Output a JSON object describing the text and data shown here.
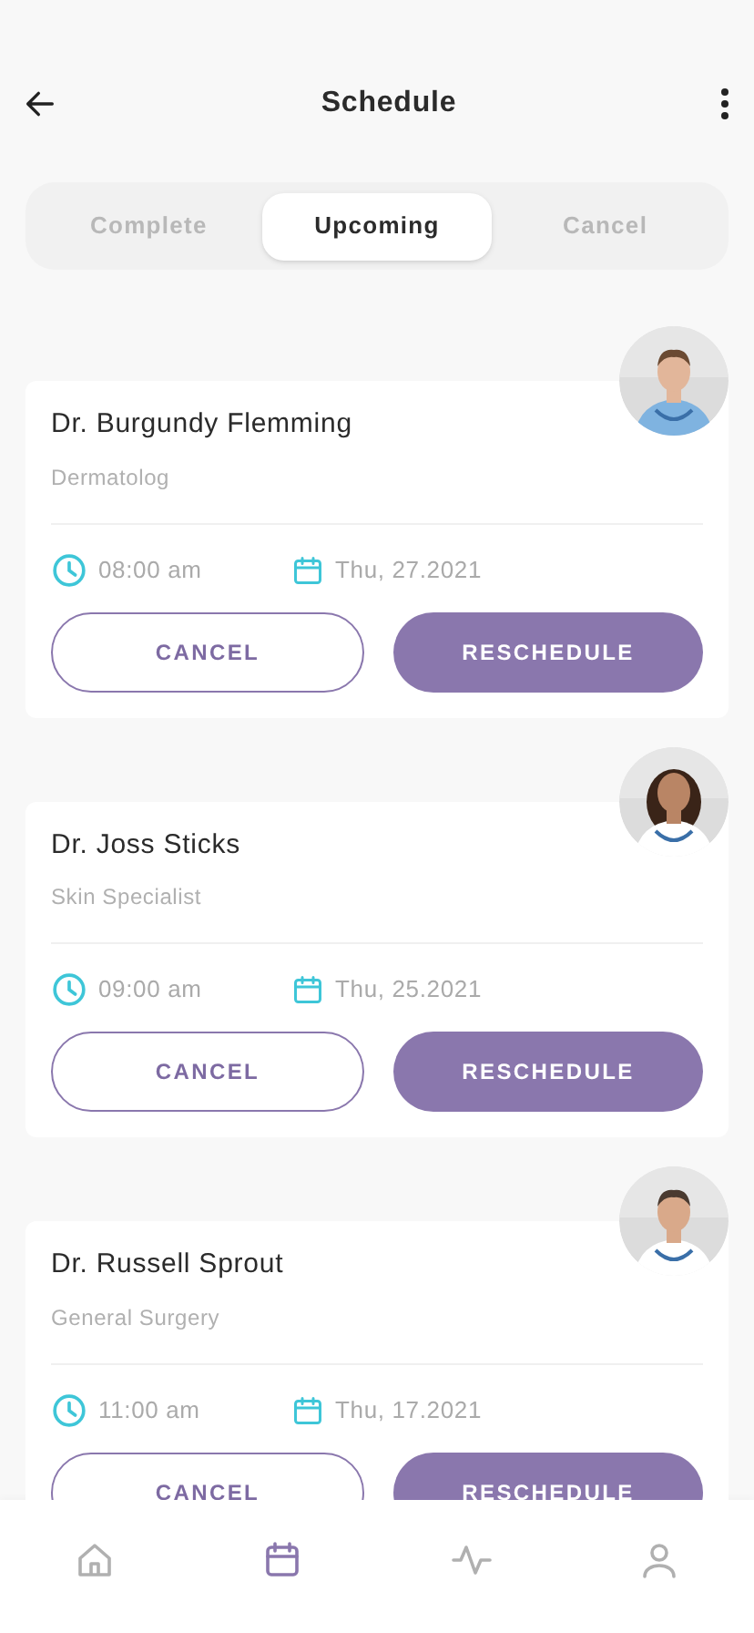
{
  "header": {
    "title": "Schedule"
  },
  "tabs": [
    {
      "label": "Complete",
      "selected": false
    },
    {
      "label": "Upcoming",
      "selected": true
    },
    {
      "label": "Cancel",
      "selected": false
    }
  ],
  "appointments": [
    {
      "doctor": "Dr. Burgundy Flemming",
      "specialty": "Dermatolog",
      "time": "08:00 am",
      "date": "Thu, 27.2021",
      "cancel_label": "CANCEL",
      "reschedule_label": "RESCHEDULE"
    },
    {
      "doctor": "Dr. Joss Sticks",
      "specialty": "Skin Specialist",
      "time": "09:00 am",
      "date": "Thu, 25.2021",
      "cancel_label": "CANCEL",
      "reschedule_label": "RESCHEDULE"
    },
    {
      "doctor": "Dr. Russell Sprout",
      "specialty": "General Surgery",
      "time": "11:00 am",
      "date": "Thu, 17.2021",
      "cancel_label": "CANCEL",
      "reschedule_label": "RESCHEDULE"
    }
  ],
  "nav": [
    {
      "kind": "home",
      "selected": false
    },
    {
      "kind": "calendar",
      "selected": true
    },
    {
      "kind": "activity",
      "selected": false
    },
    {
      "kind": "profile",
      "selected": false
    }
  ]
}
